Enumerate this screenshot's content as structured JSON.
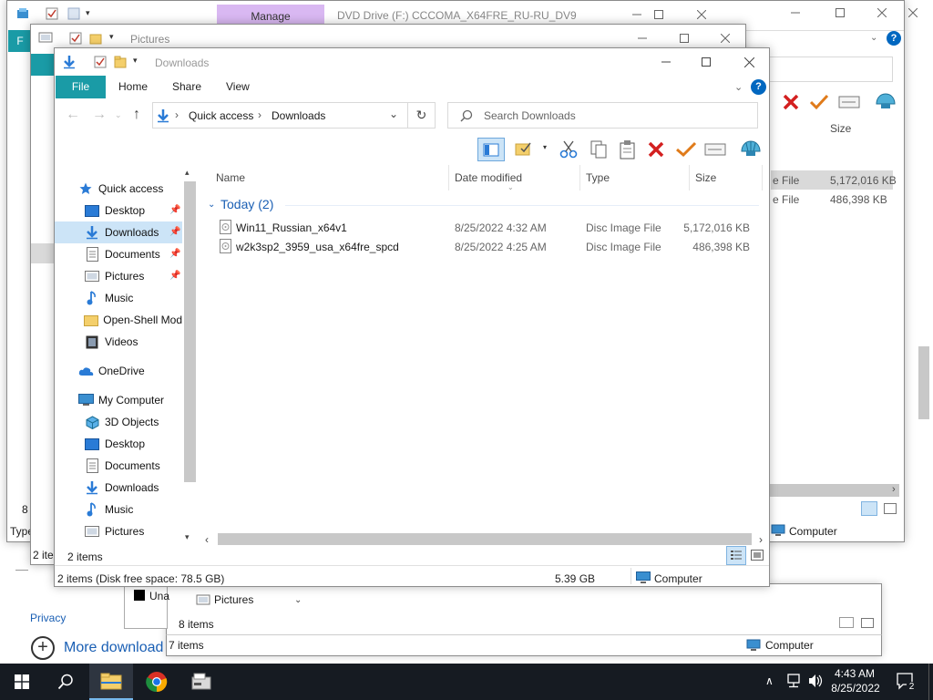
{
  "back_window_1": {
    "title": "DVD Drive (F:) CCCOMA_X64FRE_RU-RU_DV9",
    "manage_tab": "Manage",
    "file_tab_letter": "F",
    "col_size": "Size",
    "rows": [
      {
        "type": "e File",
        "size": "5,172,016 KB"
      },
      {
        "type": "e File",
        "size": "486,398 KB"
      }
    ],
    "status_items": "8 i",
    "type_label": "Type",
    "computer_label": "Computer"
  },
  "back_window_2": {
    "title": "Pictures",
    "status_items": "2 ite"
  },
  "back_window_3": {
    "nav_pictures": "Pictures",
    "status_items": "8 items",
    "unapplied": "Una"
  },
  "back_window_4": {
    "status_items": "7 items",
    "computer_label": "Computer"
  },
  "desktop": {
    "privacy": "Privacy",
    "more_downloads": "More download"
  },
  "main": {
    "title": "Downloads",
    "tabs": [
      "File",
      "Home",
      "Share",
      "View"
    ],
    "address": {
      "root": "Quick access",
      "current": "Downloads"
    },
    "search_placeholder": "Search Downloads",
    "nav": {
      "quick_access": "Quick access",
      "qa_items": [
        "Desktop",
        "Downloads",
        "Documents",
        "Pictures",
        "Music",
        "Open-Shell Mod",
        "Videos"
      ],
      "onedrive": "OneDrive",
      "my_computer": "My Computer",
      "pc_items": [
        "3D Objects",
        "Desktop",
        "Documents",
        "Downloads",
        "Music",
        "Pictures"
      ]
    },
    "columns": {
      "name": "Name",
      "date": "Date modified",
      "type": "Type",
      "size": "Size"
    },
    "group_header": "Today (2)",
    "files": [
      {
        "name": "Win11_Russian_x64v1",
        "date": "8/25/2022 4:32 AM",
        "type": "Disc Image File",
        "size": "5,172,016 KB"
      },
      {
        "name": "w2k3sp2_3959_usa_x64fre_spcd",
        "date": "8/25/2022 4:25 AM",
        "type": "Disc Image File",
        "size": "486,398 KB"
      }
    ],
    "nav_status": "2 items",
    "status": {
      "summary": "2 items (Disk free space: 78.5 GB)",
      "size": "5.39 GB",
      "location": "Computer"
    }
  },
  "taskbar": {
    "time": "4:43 AM",
    "date": "8/25/2022",
    "notification_count": "2"
  },
  "colors": {
    "file_tab": "#1a9ba6",
    "manage_tab": "#d9b8f2",
    "selection": "#cce4f7",
    "taskbar": "#161b22",
    "accent_blue": "#0067c0"
  }
}
